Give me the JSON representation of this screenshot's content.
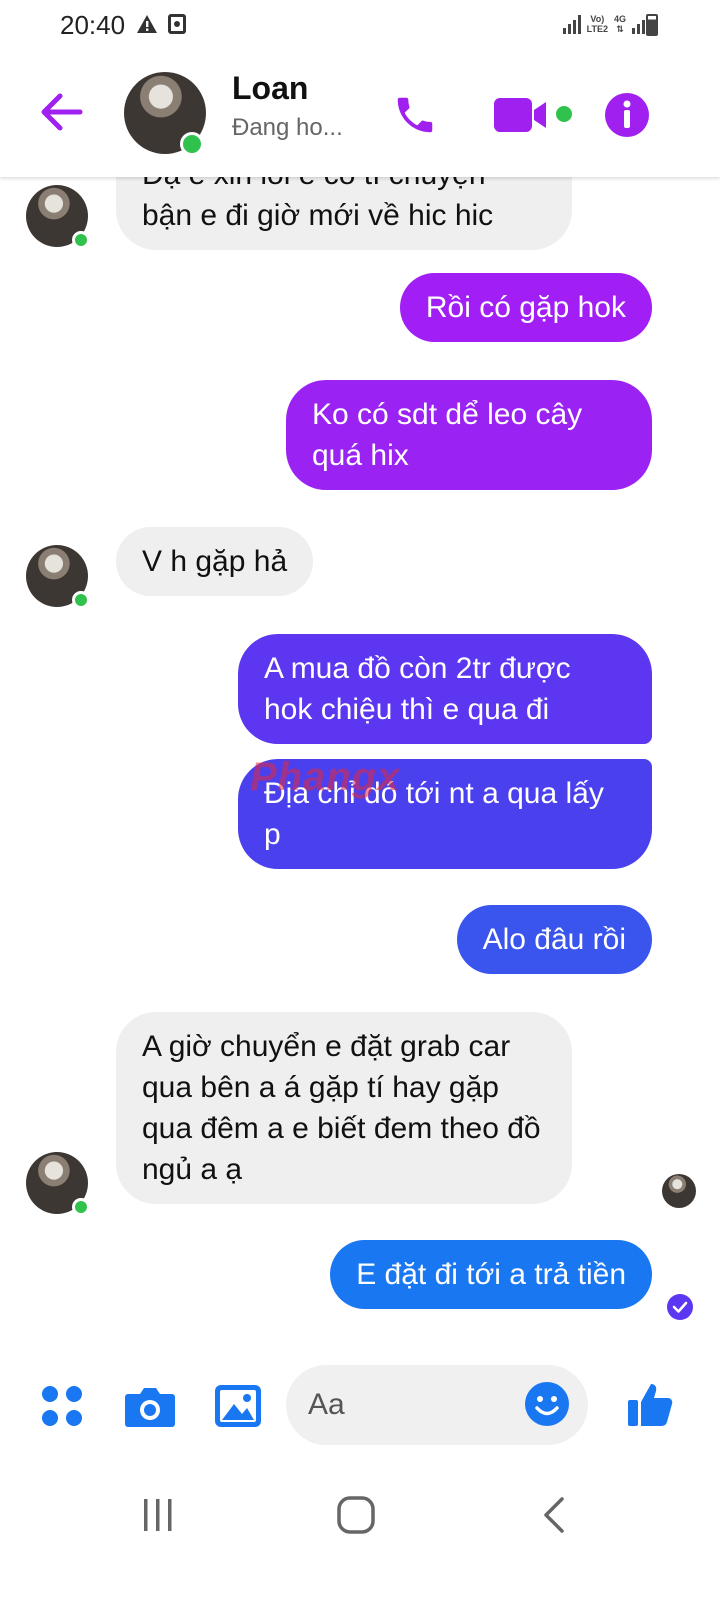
{
  "status_bar": {
    "time": "20:40",
    "network_label_top": "Vo)",
    "network_label_bottom": "LTE2",
    "network_gen": "4G"
  },
  "header": {
    "contact_name": "Loan",
    "contact_status": "Đang ho...",
    "icons": [
      "back-arrow-icon",
      "phone-icon",
      "video-camera-icon",
      "info-icon"
    ],
    "accent_color": "#a020f0",
    "online_color": "#31c24d"
  },
  "messages": [
    {
      "direction": "incoming",
      "text": "Dạ e xin lỗi e có tí chuyện bận e đi giờ mới về hic hic",
      "visible_text_1": "Dạ e xin lỗi e có tí chuyện",
      "visible_text_2": "bận e đi giờ mới về hic hic"
    },
    {
      "direction": "outgoing",
      "text": "Rồi có gặp hok",
      "color": "#a11ef5"
    },
    {
      "direction": "outgoing",
      "text": "Ko có sdt dể leo cây quá hix",
      "color": "#9a22f3"
    },
    {
      "direction": "incoming",
      "text": "V h gặp hả"
    },
    {
      "direction": "outgoing",
      "text": "A mua đồ còn 2tr được hok chiệu thì e qua đi",
      "color": "#5c36f0"
    },
    {
      "direction": "outgoing",
      "text": "Địa chỉ dó tới nt a qua lấy p",
      "color": "#4a40ee"
    },
    {
      "direction": "outgoing",
      "text": "Alo đâu rồi",
      "color": "#3a55ee"
    },
    {
      "direction": "incoming",
      "text": "A giờ chuyển e đặt grab car qua bên a  á gặp tí hay gặp qua đêm a e biết đem theo đồ ngủ a ạ"
    },
    {
      "direction": "outgoing",
      "text": "E đặt đi tới a trả tiền",
      "color": "#1a77f2"
    }
  ],
  "watermark": "Phangx",
  "composer": {
    "placeholder": "Aa",
    "icons": [
      "menu-dots-icon",
      "camera-icon",
      "image-icon",
      "emoji-icon",
      "like-thumb-icon"
    ],
    "icon_color": "#1a77f2"
  },
  "android_nav": [
    "recent-apps-icon",
    "home-icon",
    "back-icon"
  ]
}
